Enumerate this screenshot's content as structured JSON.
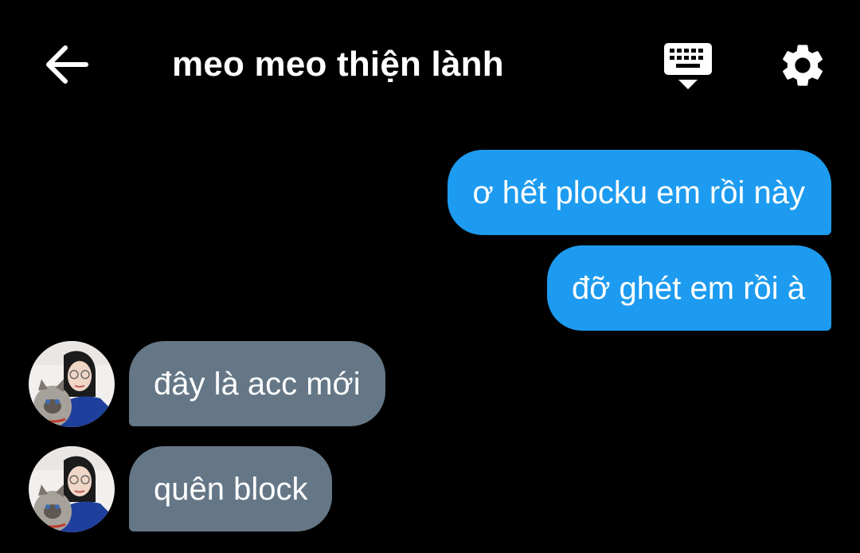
{
  "header": {
    "back_icon": "arrow-left-icon",
    "title": "meo meo thiện lành",
    "keyboard_icon": "keyboard-hide-icon",
    "settings_icon": "gear-icon"
  },
  "colors": {
    "background": "#000000",
    "sent_bubble": "#1d9bf0",
    "received_bubble": "#657786",
    "text": "#ffffff"
  },
  "messages": [
    {
      "direction": "sent",
      "text": "ơ hết plocku em rồi này"
    },
    {
      "direction": "sent",
      "text": "đỡ ghét em rồi à"
    },
    {
      "direction": "received",
      "text": "đây là acc mới",
      "avatar": "user-avatar"
    },
    {
      "direction": "received",
      "text": "quên block",
      "avatar": "user-avatar"
    }
  ]
}
